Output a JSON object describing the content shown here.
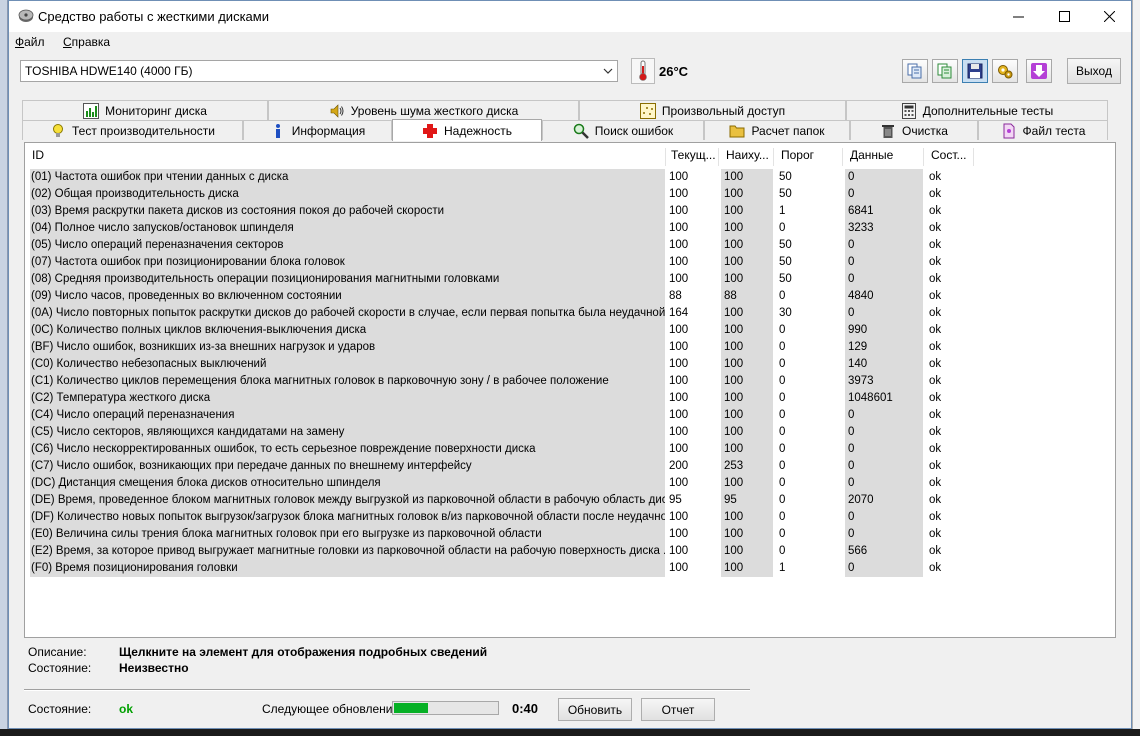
{
  "window": {
    "title": "Средство работы с жесткими дисками",
    "minimize": "minimize",
    "maximize": "maximize",
    "close": "close"
  },
  "menu": {
    "file": {
      "first": "Ф",
      "rest": "айл"
    },
    "help": {
      "first": "С",
      "rest": "правка"
    }
  },
  "toolbar": {
    "drive": "TOSHIBA HDWE140 (4000 ГБ)",
    "temperature": "26°C",
    "exit_label": "Выход",
    "icons": [
      "copy-icon",
      "copy-green-icon",
      "save-icon",
      "settings-icon",
      "download-icon"
    ]
  },
  "tabs": {
    "top": [
      "Мониторинг диска",
      "Уровень шума жесткого диска",
      "Произвольный доступ",
      "Дополнительные тесты"
    ],
    "bottom": [
      "Тест производительности",
      "Информация",
      "Надежность",
      "Поиск ошибок",
      "Расчет папок",
      "Очистка",
      "Файл теста"
    ],
    "selected": "Надежность"
  },
  "table": {
    "columns": [
      "ID",
      "Текущ...",
      "Наиху...",
      "Порог",
      "Данные",
      "Сост..."
    ],
    "rows": [
      [
        "(01) Частота ошибок при чтении данных с диска",
        "100",
        "100",
        "50",
        "0",
        "ok"
      ],
      [
        "(02) Общая производительность диска",
        "100",
        "100",
        "50",
        "0",
        "ok"
      ],
      [
        "(03) Время раскрутки пакета дисков из состояния покоя до рабочей скорости",
        "100",
        "100",
        "1",
        "6841",
        "ok"
      ],
      [
        "(04) Полное число запусков/остановок шпинделя",
        "100",
        "100",
        "0",
        "3233",
        "ok"
      ],
      [
        "(05) Число операций переназначения секторов",
        "100",
        "100",
        "50",
        "0",
        "ok"
      ],
      [
        "(07) Частота ошибок при позиционировании блока головок",
        "100",
        "100",
        "50",
        "0",
        "ok"
      ],
      [
        "(08) Средняя производительность операции позиционирования магнитными головками",
        "100",
        "100",
        "50",
        "0",
        "ok"
      ],
      [
        "(09) Число часов, проведенных во включенном состоянии",
        "88",
        "88",
        "0",
        "4840",
        "ok"
      ],
      [
        "(0A) Число повторных попыток раскрутки дисков до рабочей скорости в случае, если первая попытка была неудачной",
        "164",
        "100",
        "30",
        "0",
        "ok"
      ],
      [
        "(0C) Количество полных циклов включения-выключения диска",
        "100",
        "100",
        "0",
        "990",
        "ok"
      ],
      [
        "(BF) Число ошибок, возникших из-за внешних нагрузок и ударов",
        "100",
        "100",
        "0",
        "129",
        "ok"
      ],
      [
        "(C0) Количество небезопасных выключений",
        "100",
        "100",
        "0",
        "140",
        "ok"
      ],
      [
        "(C1) Количество циклов перемещения блока магнитных головок в парковочную зону / в рабочее положение",
        "100",
        "100",
        "0",
        "3973",
        "ok"
      ],
      [
        "(C2) Температура жесткого диска",
        "100",
        "100",
        "0",
        "1048601",
        "ok"
      ],
      [
        "(C4) Число операций переназначения",
        "100",
        "100",
        "0",
        "0",
        "ok"
      ],
      [
        "(C5) Число секторов, являющихся кандидатами на замену",
        "100",
        "100",
        "0",
        "0",
        "ok"
      ],
      [
        "(C6) Число нескорректированных ошибок, то есть серьезное повреждение поверхности диска",
        "100",
        "100",
        "0",
        "0",
        "ok"
      ],
      [
        "(C7) Число ошибок, возникающих при передаче данных по внешнему интерфейсу",
        "200",
        "253",
        "0",
        "0",
        "ok"
      ],
      [
        "(DC) Дистанция смещения блока дисков относительно шпинделя",
        "100",
        "100",
        "0",
        "0",
        "ok"
      ],
      [
        "(DE) Время, проведенное блоком магнитных головок между выгрузкой из парковочной области в рабочую область диск...",
        "95",
        "95",
        "0",
        "2070",
        "ok"
      ],
      [
        "(DF) Количество новых попыток выгрузок/загрузок блока магнитных головок в/из парковочной области после неудачно...",
        "100",
        "100",
        "0",
        "0",
        "ok"
      ],
      [
        "(E0) Величина силы трения блока магнитных головок при его выгрузке из парковочной области",
        "100",
        "100",
        "0",
        "0",
        "ok"
      ],
      [
        "(E2) Время, за которое привод выгружает магнитные головки из парковочной области на рабочую поверхность диска     ...",
        "100",
        "100",
        "0",
        "566",
        "ok"
      ],
      [
        "(F0) Время позиционирования головки",
        "100",
        "100",
        "1",
        "0",
        "ok"
      ]
    ]
  },
  "details": {
    "description_label": "Описание:",
    "description_value": "Щелкните на элемент для отображения подробных сведений",
    "state_label": "Состояние:",
    "state_value": "Неизвестно"
  },
  "status": {
    "label": "Состояние:",
    "value": "ok",
    "value_color": "#00a000",
    "next_update_label": "Следующее обновление:",
    "progress_fraction": 0.33,
    "timer": "0:40",
    "refresh_label": "Обновить",
    "report_label": "Отчет"
  }
}
